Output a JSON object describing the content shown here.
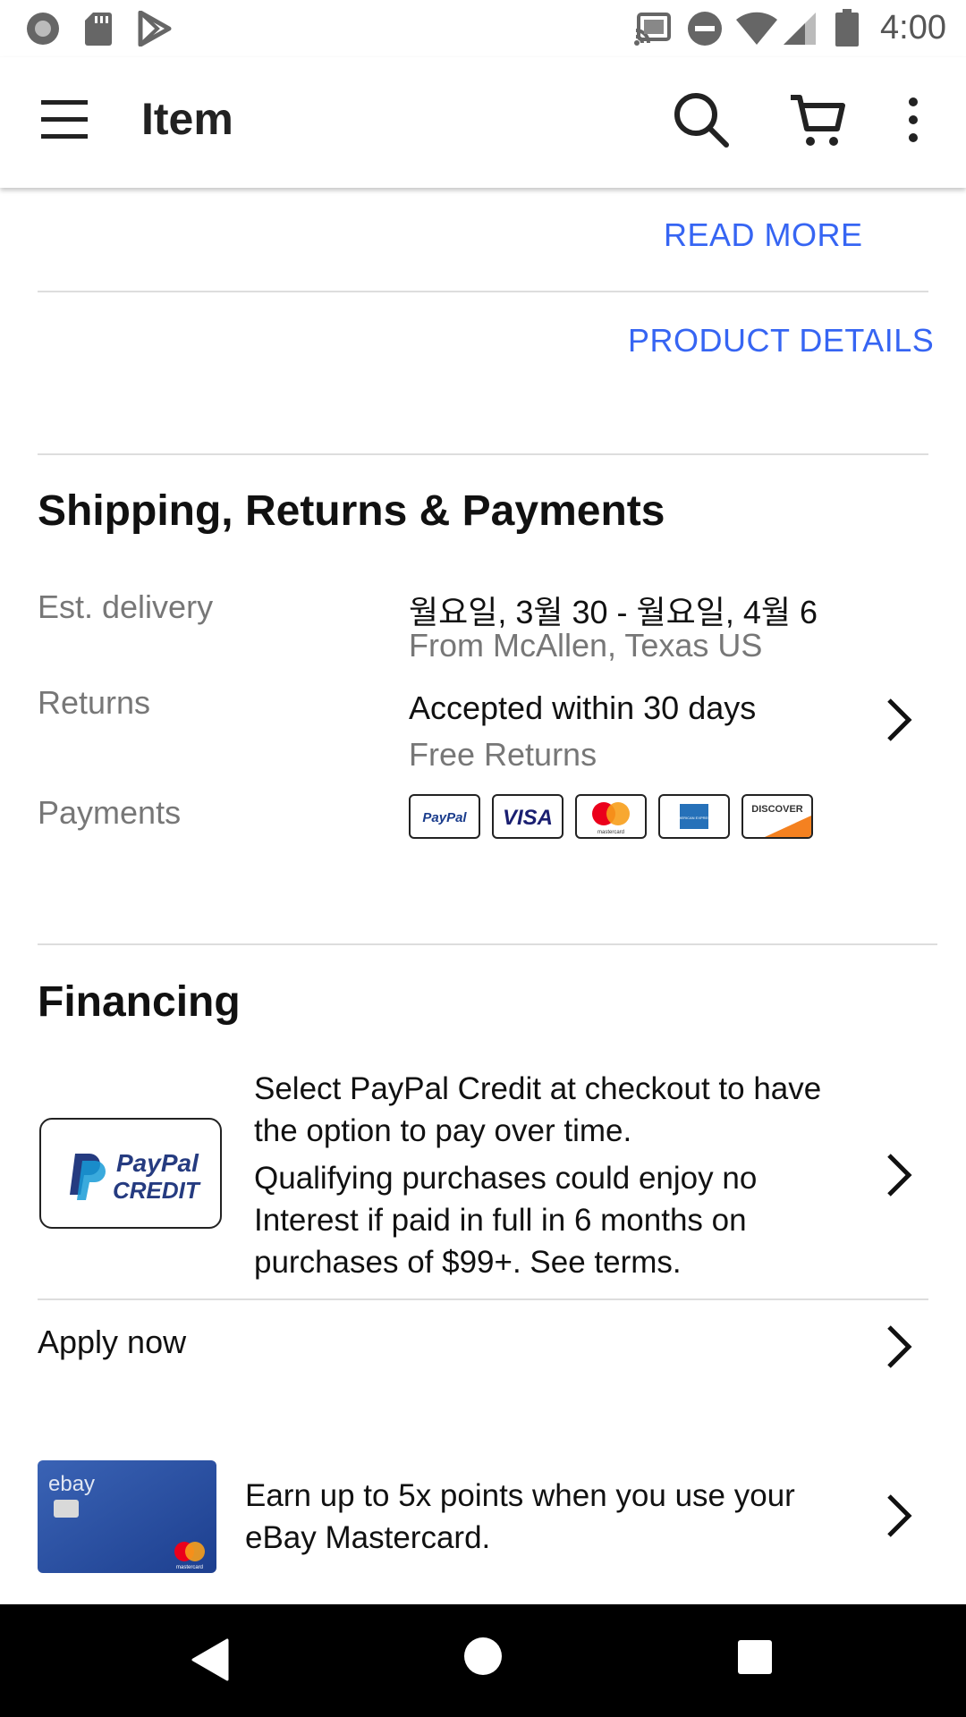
{
  "status_bar": {
    "time": "4:00",
    "left_icons": [
      "record-icon",
      "sd-card-icon",
      "play-store-icon"
    ],
    "right_icons": [
      "cast-icon",
      "do-not-disturb-icon",
      "wifi-icon",
      "signal-icon",
      "battery-icon"
    ]
  },
  "app_bar": {
    "title": "Item",
    "icons": [
      "menu-icon",
      "search-icon",
      "cart-icon",
      "more-vert-icon"
    ]
  },
  "description": {
    "read_more": "READ MORE",
    "product_details": "PRODUCT DETAILS"
  },
  "shipping": {
    "title": "Shipping, Returns & Payments",
    "delivery_label": "Est. delivery",
    "delivery_value": "월요일, 3월 30 - 월요일, 4월 6",
    "delivery_from": "From McAllen, Texas US",
    "returns_label": "Returns",
    "returns_value": "Accepted within 30 days",
    "returns_sub": "Free Returns",
    "payments_label": "Payments",
    "payment_methods": [
      "PayPal",
      "VISA",
      "mastercard",
      "AMERICAN EXPRESS",
      "DISCOVER"
    ]
  },
  "financing": {
    "title": "Financing",
    "paypal_credit_logo": [
      "PayPal",
      "CREDIT"
    ],
    "line1": "Select PayPal Credit at checkout to have",
    "line2": "the option to pay over time.",
    "line3": "Qualifying purchases could enjoy no",
    "line4": "Interest if paid in full in 6 months on",
    "line5": "purchases of $99+. See terms.",
    "apply_now": "Apply now",
    "card_brand": "ebay",
    "card_network": "mastercard",
    "mastercard_line1": "Earn up to 5x points when you use your",
    "mastercard_line2": "eBay Mastercard."
  },
  "colors": {
    "link": "#3665f3",
    "text": "#111111",
    "secondary_text": "#777777",
    "divider": "#dddddd",
    "nav_bar": "#000000"
  }
}
